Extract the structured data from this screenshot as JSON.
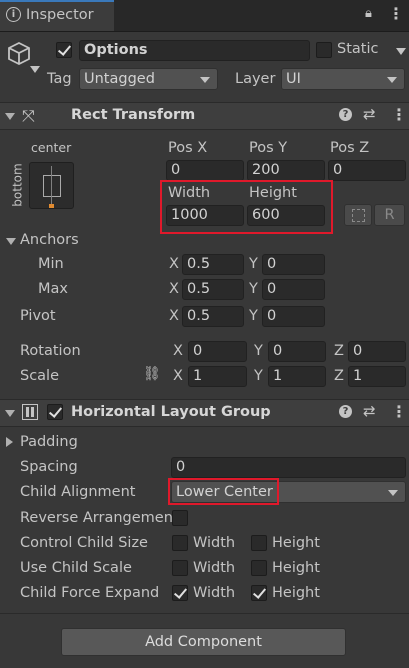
{
  "tab": {
    "title": "Inspector"
  },
  "object": {
    "name": "Options",
    "static_label": "Static",
    "tag_label": "Tag",
    "tag_value": "Untagged",
    "layer_label": "Layer",
    "layer_value": "UI"
  },
  "rect_transform": {
    "title": "Rect Transform",
    "anchor_preset_h": "center",
    "anchor_preset_v": "bottom",
    "pos_x_label": "Pos X",
    "pos_y_label": "Pos Y",
    "pos_z_label": "Pos Z",
    "pos_x": "0",
    "pos_y": "200",
    "pos_z": "0",
    "width_label": "Width",
    "height_label": "Height",
    "width": "1000",
    "height": "600",
    "r_button": "R",
    "anchors_label": "Anchors",
    "min_label": "Min",
    "max_label": "Max",
    "min_x": "0.5",
    "min_y": "0",
    "max_x": "0.5",
    "max_y": "0",
    "pivot_label": "Pivot",
    "pivot_x": "0.5",
    "pivot_y": "0",
    "rotation_label": "Rotation",
    "rot_x": "0",
    "rot_y": "0",
    "rot_z": "0",
    "scale_label": "Scale",
    "scale_x": "1",
    "scale_y": "1",
    "scale_z": "1",
    "x": "X",
    "y": "Y",
    "z": "Z"
  },
  "layout_group": {
    "title": "Horizontal Layout Group",
    "padding_label": "Padding",
    "spacing_label": "Spacing",
    "spacing": "0",
    "child_alignment_label": "Child Alignment",
    "child_alignment": "Lower Center",
    "reverse_label": "Reverse Arrangemen",
    "control_size_label": "Control Child Size",
    "use_scale_label": "Use Child Scale",
    "force_expand_label": "Child Force Expand",
    "width_label": "Width",
    "height_label": "Height"
  },
  "add_component": "Add Component"
}
